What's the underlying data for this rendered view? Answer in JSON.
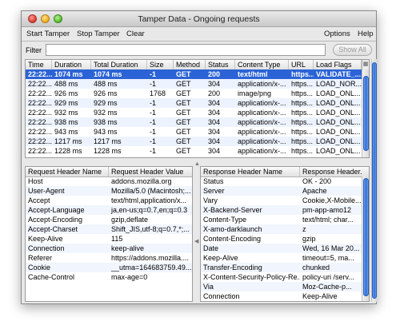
{
  "window": {
    "title": "Tamper Data - Ongoing requests"
  },
  "menu": {
    "start_tamper": "Start Tamper",
    "stop_tamper": "Stop Tamper",
    "clear": "Clear",
    "options": "Options",
    "help": "Help"
  },
  "filter": {
    "label": "Filter",
    "value": "",
    "show_all_label": "Show All"
  },
  "requests": {
    "columns": [
      "Time",
      "Duration",
      "Total Duration",
      "Size",
      "Method",
      "Status",
      "Content Type",
      "URL",
      "Load Flags"
    ],
    "rows": [
      [
        "22:22...",
        "1074 ms",
        "1074 ms",
        "-1",
        "GET",
        "200",
        "text/html",
        "https...",
        "VALIDATE_..."
      ],
      [
        "22:22...",
        "488 ms",
        "488 ms",
        "-1",
        "GET",
        "304",
        "application/x-...",
        "https...",
        "LOAD_NOR..."
      ],
      [
        "22:22...",
        "926 ms",
        "926 ms",
        "1768",
        "GET",
        "200",
        "image/png",
        "https...",
        "LOAD_ONL..."
      ],
      [
        "22:22...",
        "929 ms",
        "929 ms",
        "-1",
        "GET",
        "304",
        "application/x-...",
        "https...",
        "LOAD_ONL..."
      ],
      [
        "22:22...",
        "932 ms",
        "932 ms",
        "-1",
        "GET",
        "304",
        "application/x-...",
        "https...",
        "LOAD_ONL..."
      ],
      [
        "22:22...",
        "938 ms",
        "938 ms",
        "-1",
        "GET",
        "304",
        "application/x-...",
        "https...",
        "LOAD_ONL..."
      ],
      [
        "22:22...",
        "943 ms",
        "943 ms",
        "-1",
        "GET",
        "304",
        "application/x-...",
        "https...",
        "LOAD_ONL..."
      ],
      [
        "22:22...",
        "1217 ms",
        "1217 ms",
        "-1",
        "GET",
        "304",
        "application/x-...",
        "https...",
        "LOAD_ONL..."
      ],
      [
        "22:22...",
        "1228 ms",
        "1228 ms",
        "-1",
        "GET",
        "304",
        "application/x-...",
        "https...",
        "LOAD_ONL..."
      ]
    ],
    "selected_index": 0
  },
  "request_headers": {
    "name_header": "Request Header Name",
    "value_header": "Request Header Value",
    "rows": [
      [
        "Host",
        "addons.mozilla.org"
      ],
      [
        "User-Agent",
        "Mozilla/5.0 (Macintosh;..."
      ],
      [
        "Accept",
        "text/html,application/x..."
      ],
      [
        "Accept-Language",
        "ja,en-us;q=0.7,en;q=0.3"
      ],
      [
        "Accept-Encoding",
        "gzip,deflate"
      ],
      [
        "Accept-Charset",
        "Shift_JIS,utf-8;q=0.7,*;..."
      ],
      [
        "Keep-Alive",
        "115"
      ],
      [
        "Connection",
        "keep-alive"
      ],
      [
        "Referer",
        "https://addons.mozilla...."
      ],
      [
        "Cookie",
        "__utma=164683759.49..."
      ],
      [
        "Cache-Control",
        "max-age=0"
      ]
    ]
  },
  "response_headers": {
    "name_header": "Response Header Name",
    "value_header": "Response Header...",
    "rows": [
      [
        "Status",
        "OK - 200"
      ],
      [
        "Server",
        "Apache"
      ],
      [
        "Vary",
        "Cookie,X-Mobile..."
      ],
      [
        "X-Backend-Server",
        "pm-app-amo12"
      ],
      [
        "Content-Type",
        "text/html; char..."
      ],
      [
        "X-amo-darklaunch",
        "z"
      ],
      [
        "Content-Encoding",
        "gzip"
      ],
      [
        "Date",
        "Wed, 16 Mar 20..."
      ],
      [
        "Keep-Alive",
        "timeout=5, ma..."
      ],
      [
        "Transfer-Encoding",
        "chunked"
      ],
      [
        "X-Content-Security-Policy-Re...",
        "policy-uri /serv..."
      ],
      [
        "Via",
        "Moz-Cache-p..."
      ],
      [
        "Connection",
        "Keep-Alive"
      ]
    ]
  },
  "colors": {
    "selection": "#2b63d6",
    "scroll_thumb": "#2f6fd8"
  }
}
